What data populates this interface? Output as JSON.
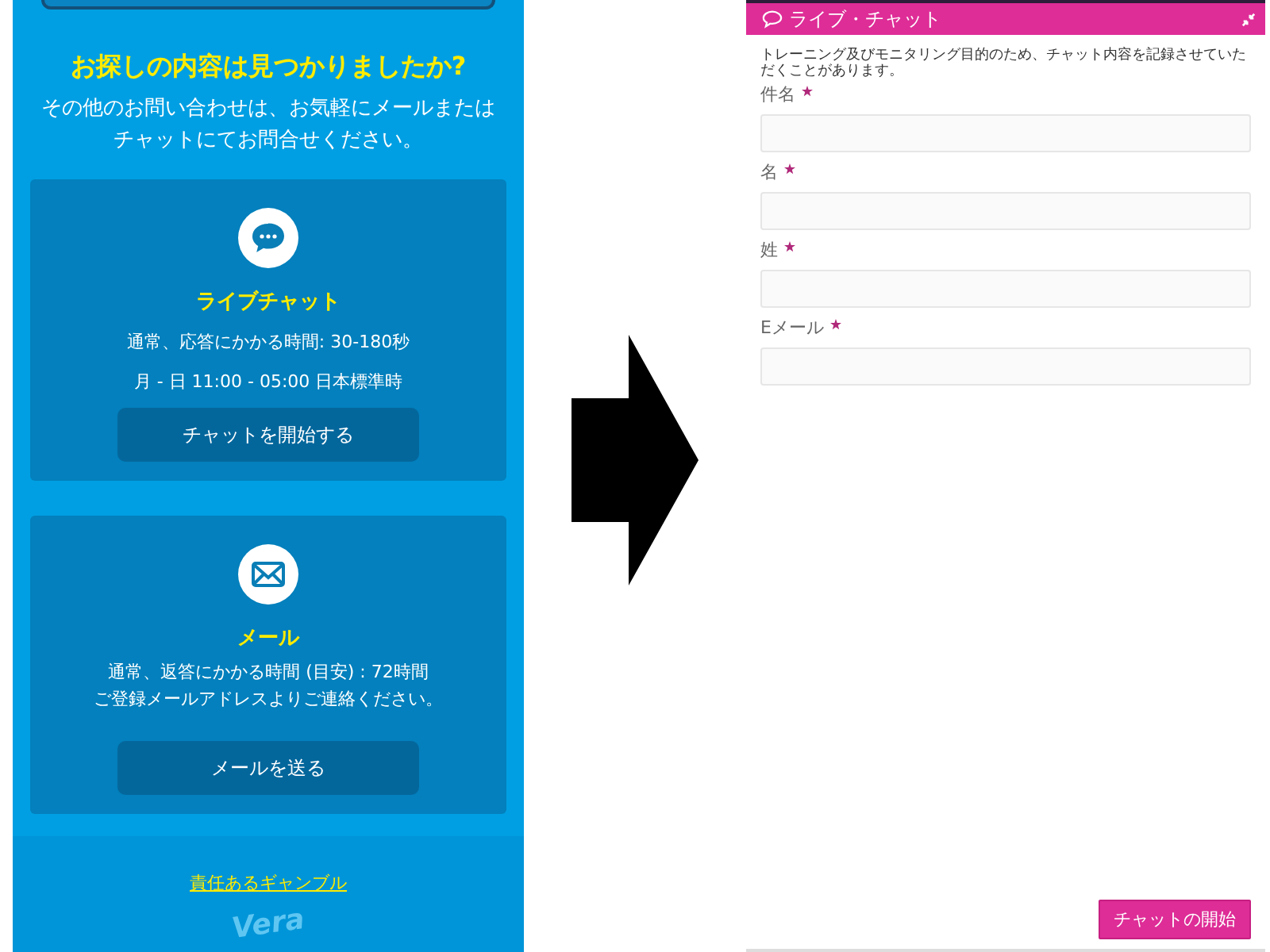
{
  "left_screen": {
    "heading": "お探しの内容は見つかりましたか?",
    "intro": "その他のお問い合わせは、お気軽にメールまたはチャットにてお問合せください。",
    "cards": [
      {
        "kind": "chat",
        "title": "ライブチャット",
        "lines": [
          "通常、応答にかかる時間: 30-180秒",
          "月 - 日 11:00 - 05:00 日本標準時"
        ],
        "button": "チャットを開始する"
      },
      {
        "kind": "mail",
        "title": "メール",
        "lines": [
          "通常、返答にかかる時間 (目安) : 72時間",
          "ご登録メールアドレスよりご連絡ください。"
        ],
        "button": "メールを送る"
      }
    ],
    "footer_link": "責任あるギャンブル",
    "logo": "Vera"
  },
  "right_screen": {
    "title": "ライブ・チャット",
    "notice": "トレーニング及びモニタリング目的のため、チャット内容を記録させていただくことがあります。",
    "fields": [
      {
        "label": "件名",
        "required": true
      },
      {
        "label": "名",
        "required": true
      },
      {
        "label": "姓",
        "required": true
      },
      {
        "label": "Eメール",
        "required": true
      }
    ],
    "submit": "チャットの開始"
  }
}
